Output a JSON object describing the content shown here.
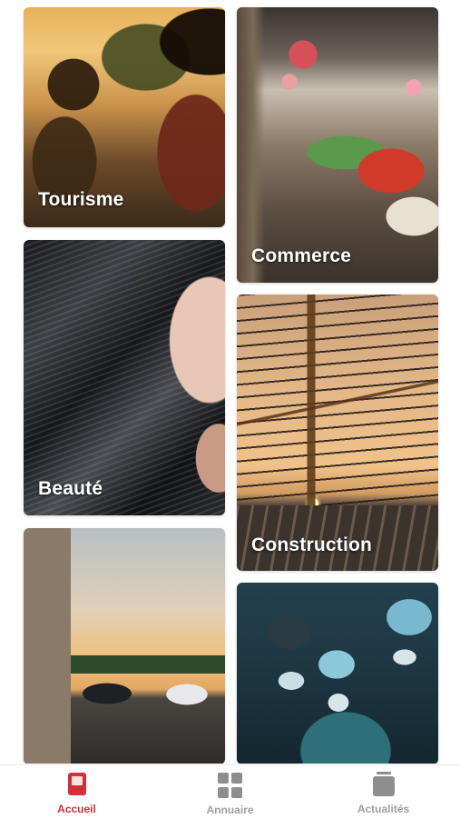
{
  "categories": [
    {
      "label": "Tourisme"
    },
    {
      "label": "Commerce"
    },
    {
      "label": "Beauté"
    },
    {
      "label": "Construction"
    },
    {
      "label": ""
    },
    {
      "label": ""
    }
  ],
  "tabbar": {
    "accent_color": "#d32f3a",
    "inactive_color": "#9e9e9e",
    "tabs": [
      {
        "label": "Accueil",
        "icon": "home-icon",
        "active": true
      },
      {
        "label": "Annuaire",
        "icon": "grid-icon",
        "active": false
      },
      {
        "label": "Actualités",
        "icon": "news-icon",
        "active": false
      }
    ]
  }
}
